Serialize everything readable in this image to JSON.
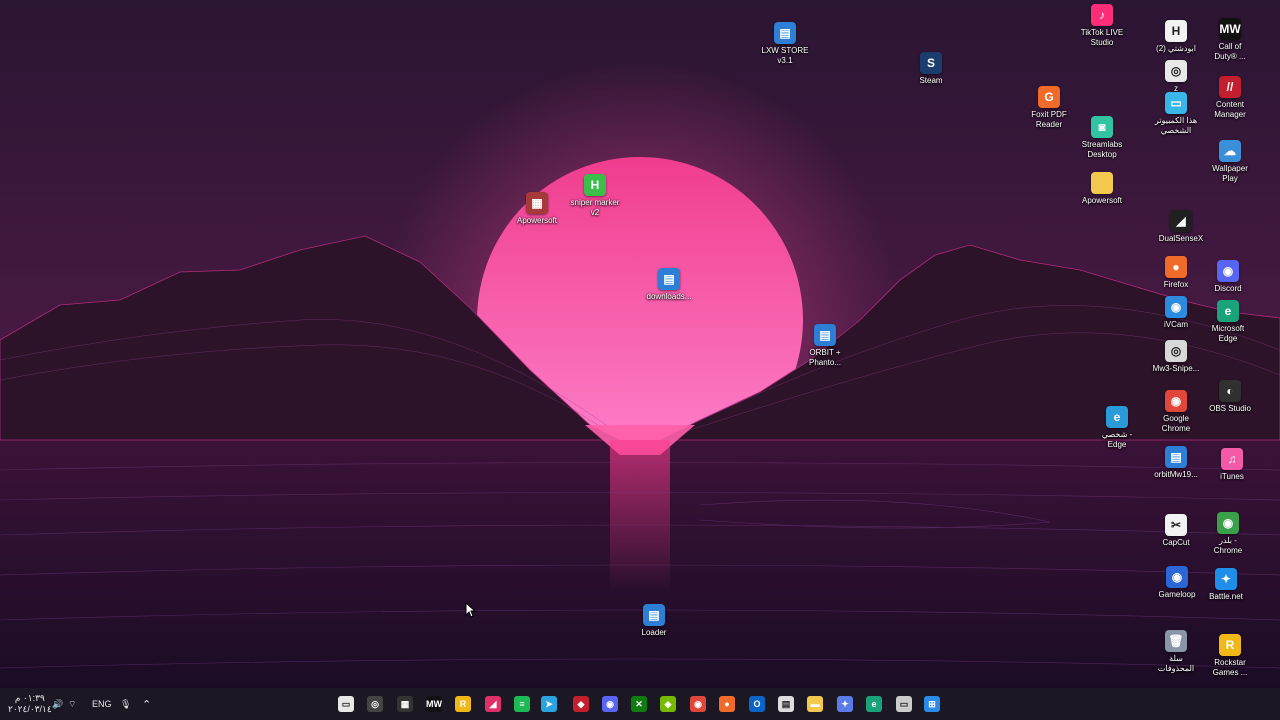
{
  "colors": {
    "sky_top": "#2a1532",
    "sky_horizon": "#6a1f57",
    "sun_top": "#f03d8e",
    "sun_bottom": "#ff86cf",
    "mountain": "#2c1329",
    "taskbar": "#1b1723",
    "ground": "#1b0c24"
  },
  "desktop_icons": [
    {
      "name": "lxw-store-icon",
      "label": "LXW STORE\nv3.1",
      "glyph": "▤",
      "color": "#2d7fd6"
    },
    {
      "name": "steam-icon",
      "label": "Steam",
      "glyph": "S",
      "color": "#1b3d6e"
    },
    {
      "name": "tiktok-live-icon",
      "label": "TikTok LIVE\nStudio",
      "glyph": "♪",
      "color": "#ff2d77"
    },
    {
      "name": "abudashti-icon",
      "label": "(2) ابودشتي",
      "glyph": "H",
      "color": "#f2f2f2"
    },
    {
      "name": "call-of-duty-icon",
      "label": "Call of\nDuty® ...",
      "glyph": "MW",
      "color": "#111111"
    },
    {
      "name": "foxit-pdf-icon",
      "label": "Foxit PDF\nReader",
      "glyph": "G",
      "color": "#f06a2a"
    },
    {
      "name": "z-app-icon",
      "label": "z",
      "glyph": "◎",
      "color": "#e8e8e8"
    },
    {
      "name": "this-pc-icon",
      "label": "هذا الكمبيوتر\nالشخصي",
      "glyph": "▭",
      "color": "#38b6e8"
    },
    {
      "name": "content-manager-icon",
      "label": "Content\nManager",
      "glyph": "//",
      "color": "#c21e2e"
    },
    {
      "name": "streamlabs-icon",
      "label": "Streamlabs\nDesktop",
      "glyph": "◙",
      "color": "#31c3a2"
    },
    {
      "name": "wallpaper-play-icon",
      "label": "Wallpaper\nPlay",
      "glyph": "☁",
      "color": "#3a8fd8"
    },
    {
      "name": "apowersoft-folder-icon",
      "label": "Apowersoft",
      "glyph": "",
      "color": "#f2c94c"
    },
    {
      "name": "dualsensex-icon",
      "label": "DualSenseX",
      "glyph": "◢",
      "color": "#202020"
    },
    {
      "name": "firefox-icon",
      "label": "Firefox",
      "glyph": "●",
      "color": "#f06b2a"
    },
    {
      "name": "discord-icon",
      "label": "Discord",
      "glyph": "◉",
      "color": "#5865f2"
    },
    {
      "name": "ivcam-icon",
      "label": "iVCam",
      "glyph": "◉",
      "color": "#2a8be0"
    },
    {
      "name": "microsoft-edge-icon",
      "label": "Microsoft\nEdge",
      "glyph": "e",
      "color": "#1aa37a"
    },
    {
      "name": "mw3-sniper-icon",
      "label": "Mw3-Snipe...",
      "glyph": "◎",
      "color": "#d8d8d8"
    },
    {
      "name": "google-chrome-icon",
      "label": "Google\nChrome",
      "glyph": "◉",
      "color": "#e0463a"
    },
    {
      "name": "obs-studio-icon",
      "label": "OBS Studio",
      "glyph": "◐",
      "color": "#303030"
    },
    {
      "name": "edge-profile-icon",
      "label": "شخصي -\nEdge",
      "glyph": "e",
      "color": "#2a9ad8"
    },
    {
      "name": "orbitmw19-icon",
      "label": "orbitMw19...",
      "glyph": "▤",
      "color": "#2d7fd6"
    },
    {
      "name": "itunes-icon",
      "label": "iTunes",
      "glyph": "♫",
      "color": "#f35ba8"
    },
    {
      "name": "capcut-icon",
      "label": "CapCut",
      "glyph": "✂",
      "color": "#f2f2f2"
    },
    {
      "name": "chrome-profile-icon",
      "label": "بلدر -\nChrome",
      "glyph": "◉",
      "color": "#3aa14a"
    },
    {
      "name": "gameloop-icon",
      "label": "Gameloop",
      "glyph": "◉",
      "color": "#2a66d8"
    },
    {
      "name": "battle-net-icon",
      "label": "Battle.net",
      "glyph": "✦",
      "color": "#1e8ee8"
    },
    {
      "name": "recycle-bin-icon",
      "label": "سلة\nالمحذوفات",
      "glyph": "🗑",
      "color": "#8a96a8"
    },
    {
      "name": "rockstar-games-icon",
      "label": "Rockstar\nGames ...",
      "glyph": "R",
      "color": "#f2b818"
    },
    {
      "name": "apowersoft-app-icon",
      "label": "Apowersoft",
      "glyph": "▦",
      "color": "#a63a3a"
    },
    {
      "name": "sniper-marker-icon",
      "label": "sniper marker\nv2",
      "glyph": "H",
      "color": "#3cbf4a"
    },
    {
      "name": "downloads-icon",
      "label": "downloads...",
      "glyph": "▤",
      "color": "#2d7fd6"
    },
    {
      "name": "orbit-phantom-icon",
      "label": "ORBIT +\nPhanto...",
      "glyph": "▤",
      "color": "#2d7fd6"
    },
    {
      "name": "loader-icon",
      "label": "Loader",
      "glyph": "▤",
      "color": "#2d7fd6"
    }
  ],
  "taskbar": {
    "apps": [
      {
        "name": "file-explorer-taskbar-icon",
        "glyph": "▭",
        "color": "#e8e8e8"
      },
      {
        "name": "app-2-taskbar-icon",
        "glyph": "◎",
        "color": "#444444"
      },
      {
        "name": "app-3-taskbar-icon",
        "glyph": "▦",
        "color": "#333333"
      },
      {
        "name": "mw-taskbar-icon",
        "glyph": "MW",
        "color": "#111111"
      },
      {
        "name": "rockstar-taskbar-icon",
        "glyph": "R",
        "color": "#f2b818"
      },
      {
        "name": "forza-taskbar-icon",
        "glyph": "◢",
        "color": "#e0306a"
      },
      {
        "name": "spotify-taskbar-icon",
        "glyph": "≡",
        "color": "#1db954"
      },
      {
        "name": "telegram-taskbar-icon",
        "glyph": "➤",
        "color": "#2aa3e0"
      },
      {
        "name": "red-app-taskbar-icon",
        "glyph": "◆",
        "color": "#c21e2e"
      },
      {
        "name": "discord-taskbar-icon",
        "glyph": "◉",
        "color": "#5865f2"
      },
      {
        "name": "xbox-taskbar-icon",
        "glyph": "✕",
        "color": "#107c10"
      },
      {
        "name": "nvidia-taskbar-icon",
        "glyph": "◈",
        "color": "#76b900"
      },
      {
        "name": "chrome-taskbar-icon",
        "glyph": "◉",
        "color": "#e0463a"
      },
      {
        "name": "firefox-taskbar-icon",
        "glyph": "●",
        "color": "#f06b2a"
      },
      {
        "name": "outlook-taskbar-icon",
        "glyph": "O",
        "color": "#0a64c8"
      },
      {
        "name": "store-taskbar-icon",
        "glyph": "▤",
        "color": "#dddddd"
      },
      {
        "name": "folder-taskbar-icon",
        "glyph": "▬",
        "color": "#f2c94c"
      },
      {
        "name": "copilot-taskbar-icon",
        "glyph": "✦",
        "color": "#5a7be8"
      },
      {
        "name": "edge-taskbar-icon",
        "glyph": "e",
        "color": "#1aa37a"
      },
      {
        "name": "task-view-taskbar-icon",
        "glyph": "▭",
        "color": "#cccccc"
      },
      {
        "name": "start-taskbar-icon",
        "glyph": "⊞",
        "color": "#2a8be8"
      }
    ],
    "clock_time": "٠١:٣٩ م",
    "clock_date": "٢٠٢٤/٠٣/١٤",
    "language": "ENG"
  }
}
